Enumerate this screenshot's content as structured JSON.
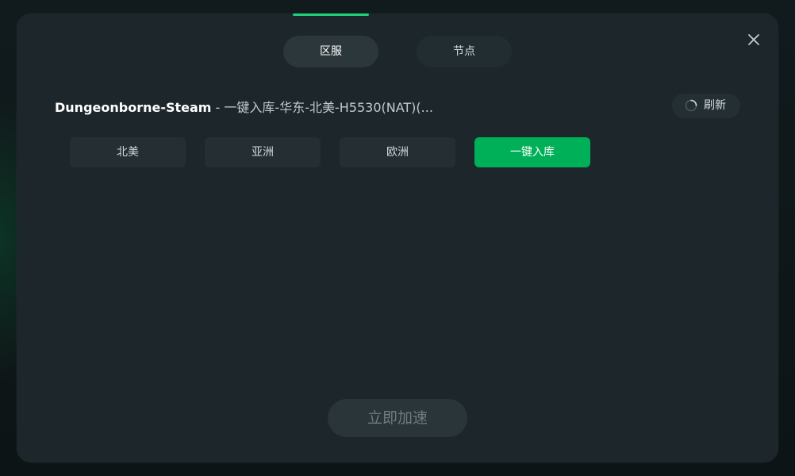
{
  "dialog": {
    "tabs": [
      {
        "label": "区服",
        "active": true
      },
      {
        "label": "节点",
        "active": false
      }
    ],
    "close_icon": "close-icon"
  },
  "route": {
    "game_name": "Dungeonborne-Steam",
    "separator": " - ",
    "path": "一键入库-华东-北美-H5530(NAT)(..."
  },
  "refresh": {
    "label": "刷新",
    "icon": "refresh-spinner-icon"
  },
  "regions": [
    {
      "label": "北美",
      "active": false
    },
    {
      "label": "亚洲",
      "active": false
    },
    {
      "label": "欧洲",
      "active": false
    },
    {
      "label": "一键入库",
      "active": true
    }
  ],
  "accelerate": {
    "label": "立即加速"
  },
  "colors": {
    "accent": "#00b058",
    "indicator": "#1fd27a",
    "dialog_bg": "#1d272b"
  }
}
